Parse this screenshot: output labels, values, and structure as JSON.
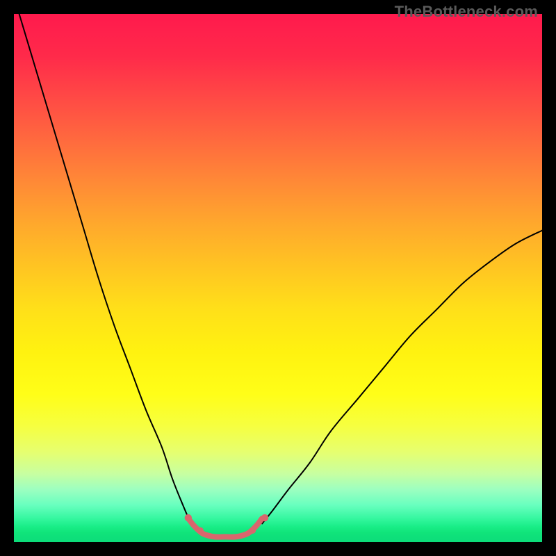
{
  "watermark": "TheBottleneck.com",
  "chart_data": {
    "type": "line",
    "title": "",
    "xlabel": "",
    "ylabel": "",
    "xlim": [
      0,
      100
    ],
    "ylim": [
      0,
      100
    ],
    "grid": false,
    "gradient_colors": {
      "top": "#ff1a4d",
      "mid": "#fffe18",
      "bottom": "#0cdc7a"
    },
    "series": [
      {
        "name": "left-branch",
        "stroke": "#000000",
        "stroke_width": 2,
        "x": [
          1,
          4,
          7,
          10,
          13,
          16,
          19,
          22,
          25,
          28,
          30,
          32,
          33.5
        ],
        "y": [
          100,
          90,
          80,
          70,
          60,
          50,
          41,
          33,
          25,
          18,
          12,
          7,
          3.5
        ]
      },
      {
        "name": "right-branch",
        "stroke": "#000000",
        "stroke_width": 2,
        "x": [
          47,
          49,
          52,
          56,
          60,
          65,
          70,
          75,
          80,
          85,
          90,
          95,
          100
        ],
        "y": [
          3.5,
          6,
          10,
          15,
          21,
          27,
          33,
          39,
          44,
          49,
          53,
          56.5,
          59
        ]
      },
      {
        "name": "bottom-highlight",
        "stroke": "#d9666d",
        "stroke_width": 8,
        "x": [
          33,
          34,
          35,
          36,
          38,
          40,
          42,
          44,
          45,
          46,
          47
        ],
        "y": [
          4.5,
          3.2,
          2.2,
          1.5,
          1,
          1,
          1,
          1.5,
          2.2,
          3.2,
          4.5
        ]
      }
    ],
    "markers": [
      {
        "cx": 33,
        "cy": 4.6,
        "r": 5.2,
        "fill": "#d9666d"
      },
      {
        "cx": 35.3,
        "cy": 2.2,
        "r": 4.6,
        "fill": "#d9666d"
      },
      {
        "cx": 45.2,
        "cy": 2.2,
        "r": 4.6,
        "fill": "#d9666d"
      },
      {
        "cx": 47.5,
        "cy": 4.6,
        "r": 5.2,
        "fill": "#d9666d"
      }
    ]
  }
}
